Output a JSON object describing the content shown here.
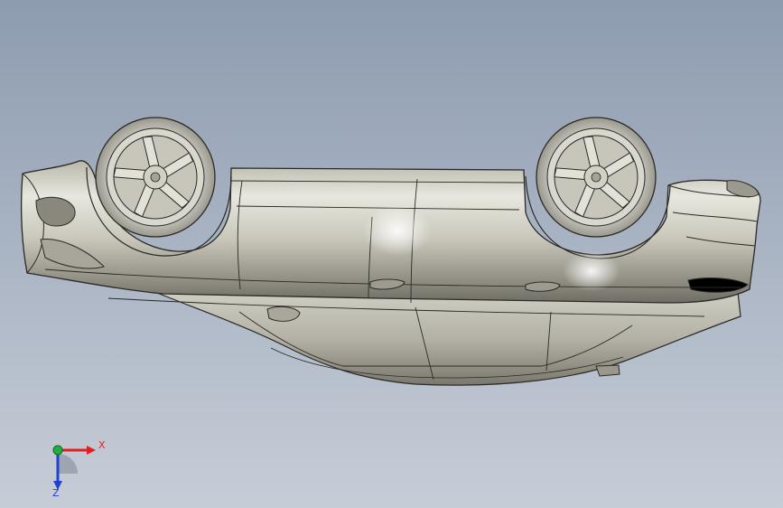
{
  "viewport": {
    "background_top": "#8e9cb0",
    "background_bottom": "#c7cdd7"
  },
  "model": {
    "body_color": "#c6c4b7",
    "highlight_color": "#f0efe7",
    "shadow_color": "#6f6d63",
    "edge_color": "#2a2a26"
  },
  "triad": {
    "x_label": "X",
    "z_label": "Z",
    "x_color": "#e02020",
    "y_color": "#20b040",
    "z_color": "#2040d0"
  }
}
